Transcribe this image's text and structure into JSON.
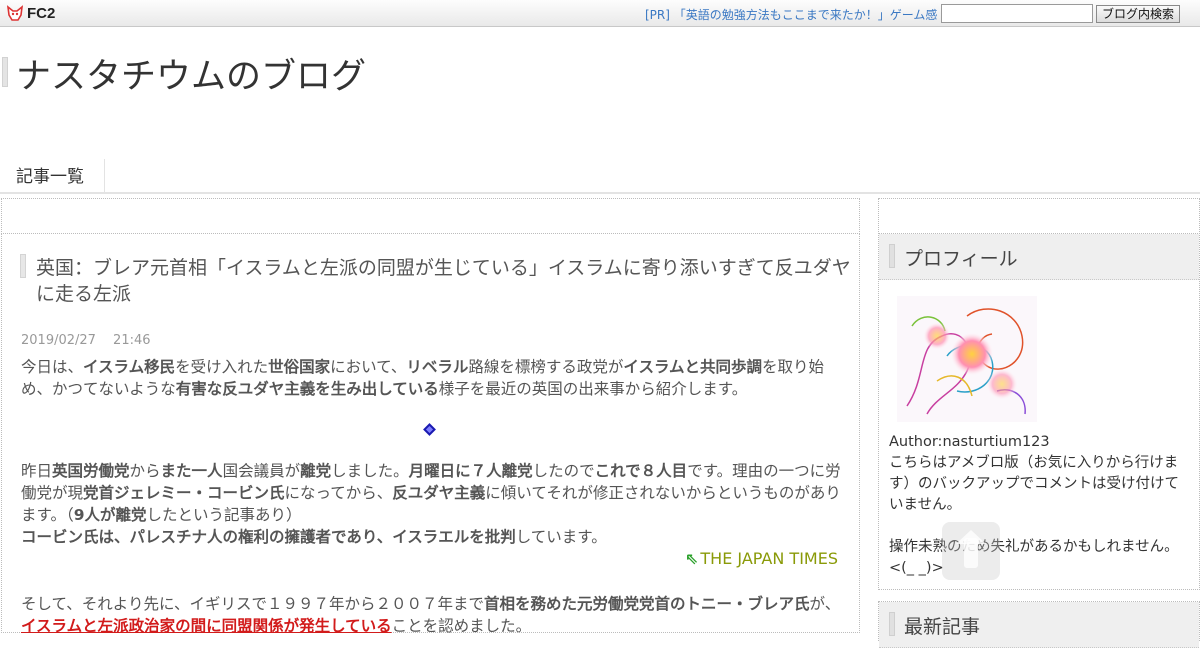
{
  "topbar": {
    "logo_text": "FC2",
    "pr_link": "[PR] 「英語の勉強方法もここまで来たか！」ゲーム感",
    "search_value": "",
    "search_button": "ブログ内検索"
  },
  "blog": {
    "title": "ナスタチウムのブログ"
  },
  "nav": {
    "items": [
      "記事一覧"
    ]
  },
  "article": {
    "title": "英国：ブレア元首相「イスラムと左派の同盟が生じている」イスラムに寄り添いすぎて反ユダヤに走る左派",
    "date": "2019/02/27　 21:46",
    "source_link": "THE JAPAN TIMES"
  },
  "sidebar": {
    "profile_heading": "プロフィール",
    "author": "Author:nasturtium123",
    "bio_1": "こちらはアメブロ版（お気に入りから行けます）のバックアップでコメントは受け付けていません。",
    "bio_2": "操作未熟のため失礼があるかもしれません。",
    "bio_3": "<(_ _)>",
    "recent_heading": "最新記事"
  },
  "colors": {
    "link_blue": "#3a78c3",
    "source_link": "#8a9a08",
    "emphasis_red": "#d21b1b"
  }
}
